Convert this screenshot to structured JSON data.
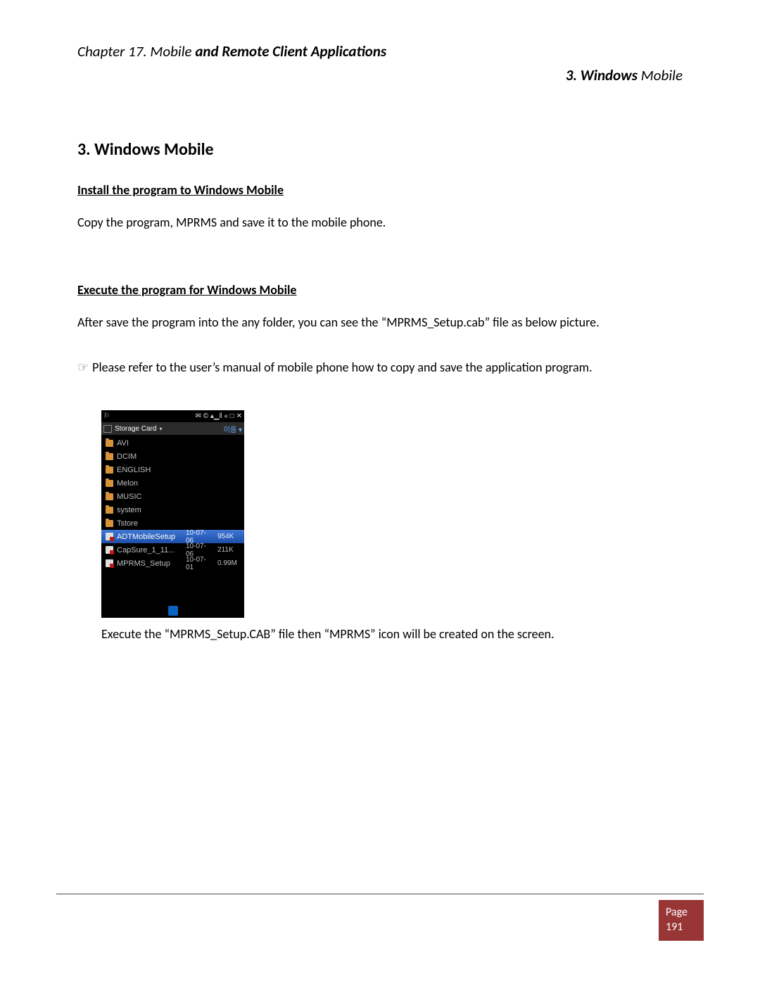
{
  "header": {
    "chapter_prefix": "Chapter 17.  Mobile",
    "chapter_bold": " and Remote Client Applications",
    "topright_bold": "3. Windows ",
    "topright_light": "Mobile"
  },
  "section_heading": "3. Windows Mobile",
  "sub1": "Install the program to Windows Mobile",
  "para1": "Copy the program, MPRMS and save it to the mobile phone.",
  "sub2": "Execute the program for Windows Mobile",
  "para2": "After save the program into the any folder, you can see the “MPRMS_Setup.cab” file as below picture.",
  "note": "Please refer to the user’s manual of mobile phone how to copy and save the application program.",
  "note_glyph": "☞",
  "phone": {
    "status_left": "⚐",
    "status_right": "✉ © ▴▁‖ «  □ ✕",
    "location": "Storage Card",
    "loc_arrow": "▾",
    "bar_right": "이름 ▾",
    "folders": [
      "AVI",
      "DCIM",
      "ENGLISH",
      "Melon",
      "MUSIC",
      "system",
      "Tstore"
    ],
    "files": [
      {
        "name": "ADTMobileSetup",
        "date": "10-07-06",
        "size": "954K",
        "selected": true
      },
      {
        "name": "CapSure_1_11...",
        "date": "10-07-06",
        "size": "211K",
        "selected": false
      },
      {
        "name": "MPRMS_Setup",
        "date": "10-07-01",
        "size": "0.99M",
        "selected": false
      }
    ]
  },
  "caption": "Execute the “MPRMS_Setup.CAB” file then “MPRMS” icon will be created on the screen.",
  "footer": {
    "label": "Page",
    "number": "191"
  }
}
